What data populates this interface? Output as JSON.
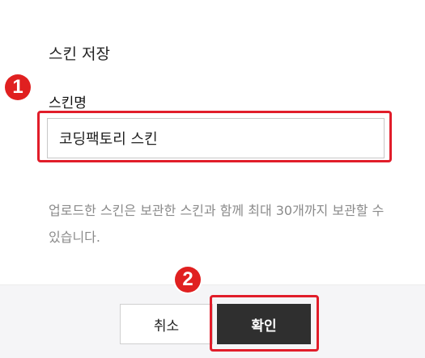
{
  "dialog": {
    "title": "스킨 저장",
    "field_label": "스킨명",
    "input_value": "코딩팩토리 스킨",
    "help_text": "업로드한 스킨은 보관한 스킨과 함께 최대 30개까지 보관할 수 있습니다."
  },
  "annotations": {
    "step1": "1",
    "step2": "2",
    "highlight_color": "#e11d2a"
  },
  "buttons": {
    "cancel_label": "취소",
    "confirm_label": "확인"
  }
}
